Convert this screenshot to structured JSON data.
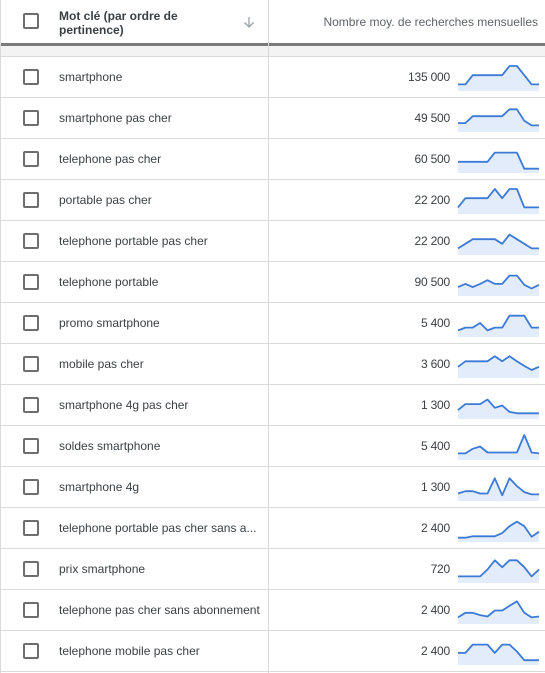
{
  "header": {
    "keyword_column": "Mot clé (par ordre de pertinence)",
    "volume_column": "Nombre moy. de recherches mensuelles",
    "sort_icon": "arrow-down-icon"
  },
  "colors": {
    "sparkline_line": "#3c7ad6",
    "sparkline_fill": "#e3ecfa",
    "header_border": "#7a7a7a",
    "row_divider": "#dadada",
    "spacer_row": "#f3f3f3"
  },
  "rows": [
    {
      "keyword": "smartphone",
      "volume": "135 000",
      "trend": [
        1,
        1,
        3,
        3,
        3,
        3,
        3,
        5,
        5,
        3,
        1,
        1
      ]
    },
    {
      "keyword": "smartphone pas cher",
      "volume": "49 500",
      "trend": [
        1.5,
        1.5,
        3,
        3,
        3,
        3,
        3,
        4.5,
        4.5,
        2,
        1,
        1
      ]
    },
    {
      "keyword": "telephone pas cher",
      "volume": "60 500",
      "trend": [
        2,
        2,
        2,
        2,
        2,
        4,
        4,
        4,
        4,
        0.5,
        0.5,
        0.5
      ]
    },
    {
      "keyword": "portable pas cher",
      "volume": "22 200",
      "trend": [
        1,
        3,
        3,
        3,
        3,
        5,
        3,
        5,
        5,
        1,
        1,
        1
      ]
    },
    {
      "keyword": "telephone portable pas cher",
      "volume": "22 200",
      "trend": [
        1,
        2,
        3,
        3,
        3,
        3,
        2,
        4,
        3,
        2,
        1,
        1
      ]
    },
    {
      "keyword": "telephone portable",
      "volume": "90 500",
      "trend": [
        1.5,
        2.2,
        1.5,
        2.2,
        3,
        2.2,
        2.2,
        4,
        4,
        2,
        1.2,
        2
      ]
    },
    {
      "keyword": "promo smartphone",
      "volume": "5 400",
      "trend": [
        1,
        1.6,
        1.6,
        2.6,
        1,
        1.6,
        1.6,
        4.2,
        4.2,
        4.2,
        1.6,
        1.6
      ]
    },
    {
      "keyword": "mobile pas cher",
      "volume": "3 600",
      "trend": [
        2,
        3.2,
        3.2,
        3.2,
        3.2,
        4.3,
        3.2,
        4.3,
        3.2,
        2.2,
        1.3,
        2
      ]
    },
    {
      "keyword": "smartphone 4g pas cher",
      "volume": "1 300",
      "trend": [
        1.5,
        2.8,
        2.8,
        2.8,
        3.8,
        2,
        2.5,
        1.1,
        0.8,
        0.8,
        0.8,
        0.8
      ]
    },
    {
      "keyword": "soldes smartphone",
      "volume": "5 400",
      "trend": [
        1,
        1,
        2,
        2.5,
        1.2,
        1.2,
        1.2,
        1.2,
        1.2,
        5,
        1.2,
        1
      ]
    },
    {
      "keyword": "smartphone 4g",
      "volume": "1 300",
      "trend": [
        1.2,
        1.7,
        1.7,
        1.2,
        1.2,
        4.5,
        0.8,
        4.5,
        2.8,
        1.5,
        1,
        1
      ]
    },
    {
      "keyword": "telephone portable pas cher sans a...",
      "volume": "2 400",
      "trend": [
        0.5,
        0.5,
        0.8,
        0.8,
        0.8,
        0.8,
        1.5,
        3,
        4,
        3,
        0.7,
        1.8
      ]
    },
    {
      "keyword": "prix smartphone",
      "volume": "720",
      "trend": [
        1,
        1,
        1,
        1,
        2.5,
        4.5,
        3,
        4.5,
        4.5,
        3,
        1,
        2.5
      ]
    },
    {
      "keyword": "telephone pas cher sans abonnement",
      "volume": "2 400",
      "trend": [
        1,
        2,
        2,
        1.5,
        1.2,
        2.5,
        2.5,
        3.5,
        4.5,
        2,
        1,
        1.2
      ]
    },
    {
      "keyword": "telephone mobile pas cher",
      "volume": "2 400",
      "trend": [
        2.2,
        2.2,
        4,
        4,
        4,
        2.2,
        4,
        4,
        2.5,
        0.6,
        0.6,
        0.6
      ]
    }
  ]
}
